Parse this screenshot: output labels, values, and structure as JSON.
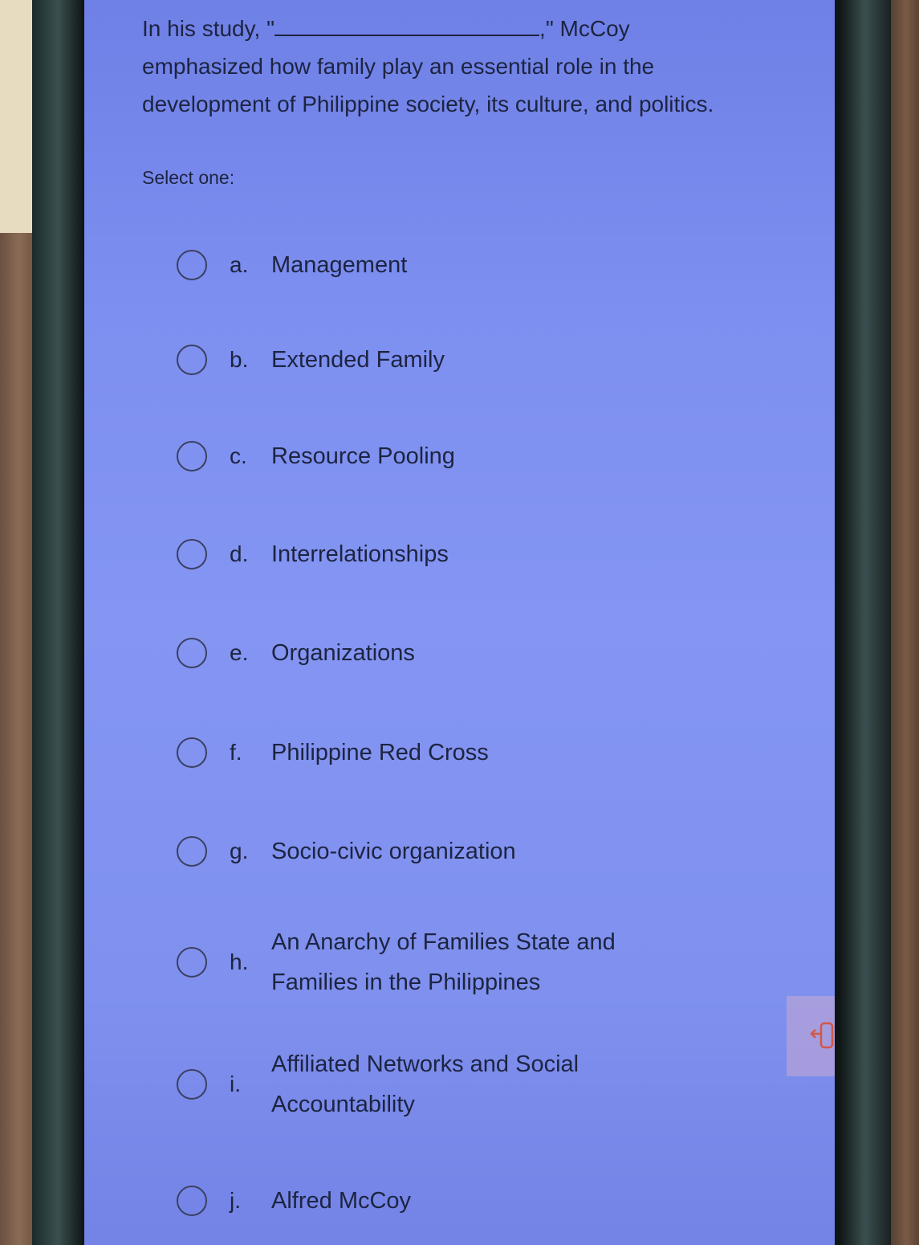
{
  "question": {
    "prefix": "In his study, \"",
    "suffix": ",\" McCoy emphasized how family play an essential role in the development of Philippine society, its culture, and politics.",
    "instruction": "Select one:"
  },
  "options": [
    {
      "letter": "a.",
      "text": "Management"
    },
    {
      "letter": "b.",
      "text": "Extended Family"
    },
    {
      "letter": "c.",
      "text": "Resource Pooling"
    },
    {
      "letter": "d.",
      "text": "Interrelationships"
    },
    {
      "letter": "e.",
      "text": "Organizations"
    },
    {
      "letter": "f.",
      "text": "Philippine Red Cross"
    },
    {
      "letter": "g.",
      "text": "Socio-civic organization"
    },
    {
      "letter": "h.",
      "text": "An Anarchy of Families State and Families in the Philippines"
    },
    {
      "letter": "i.",
      "text": "Affiliated Networks and Social Accountability"
    },
    {
      "letter": "j.",
      "text": "Alfred McCoy"
    }
  ],
  "floating_button": {
    "icon": "exit-icon",
    "color": "#d0584a"
  }
}
